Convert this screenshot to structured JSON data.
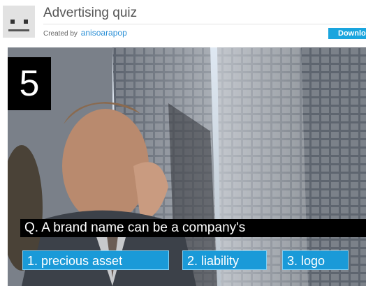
{
  "header": {
    "title": "Advertising quiz",
    "created_by_label": "Created by",
    "author": "anisoarapop",
    "download_label": "Download"
  },
  "slide": {
    "counter": "5",
    "question": "Q. A brand name can be a company's",
    "answers": [
      {
        "label": "1. precious asset"
      },
      {
        "label": "2. liability"
      },
      {
        "label": "3. logo"
      }
    ]
  },
  "colors": {
    "accent": "#1aa5de",
    "author_link": "#2a8fd6",
    "answer_bg": "#1a9ad8"
  }
}
